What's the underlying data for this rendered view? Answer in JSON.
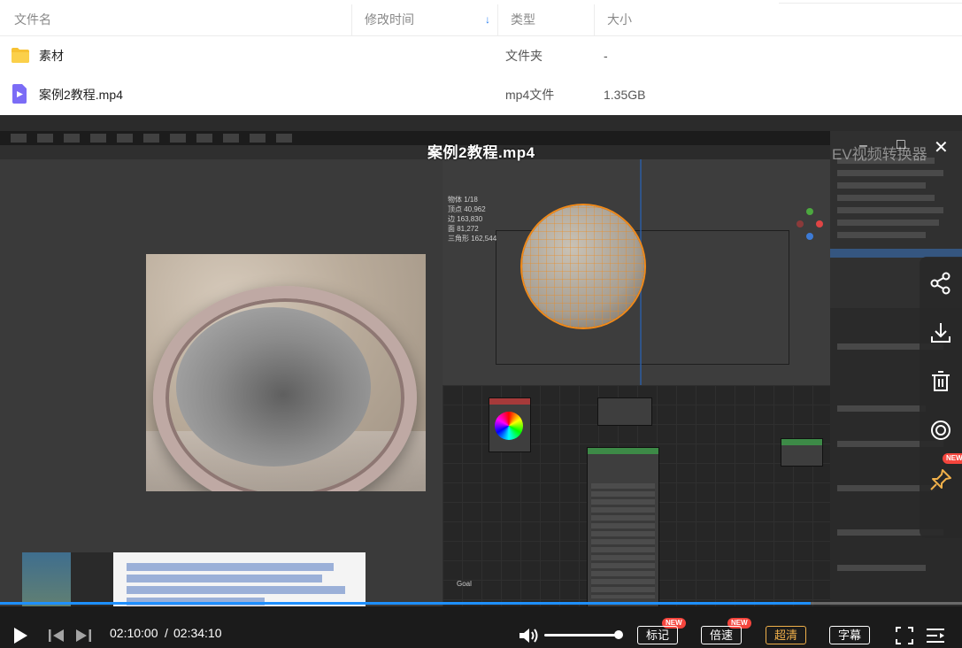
{
  "file_list": {
    "columns": {
      "name": "文件名",
      "modified": "修改时间",
      "type": "类型",
      "size": "大小"
    },
    "rows": [
      {
        "name": "素材",
        "type": "文件夹",
        "size": "-"
      },
      {
        "name": "案例2教程.mp4",
        "type": "mp4文件",
        "size": "1.35GB"
      }
    ]
  },
  "player": {
    "title": "案例2教程.mp4",
    "watermark": "EV视频转换器",
    "time_current": "02:10:00",
    "time_separator": "/",
    "time_total": "02:34:10",
    "progress_fraction": 0.843,
    "volume_fraction": 1.0,
    "buttons": {
      "mark": "标记",
      "speed": "倍速",
      "quality": "超清",
      "subtitle": "字幕"
    },
    "badge_new": "NEW",
    "accent_color": "#1e90ff",
    "quality_color": "#f0b04a",
    "badge_color": "#f5453d"
  },
  "blender": {
    "stats": [
      "物体 1/18",
      "顶点 40,962",
      "边 163,830",
      "面 81,272",
      "三角形 162,544"
    ],
    "node_editor_label": "Goal"
  }
}
